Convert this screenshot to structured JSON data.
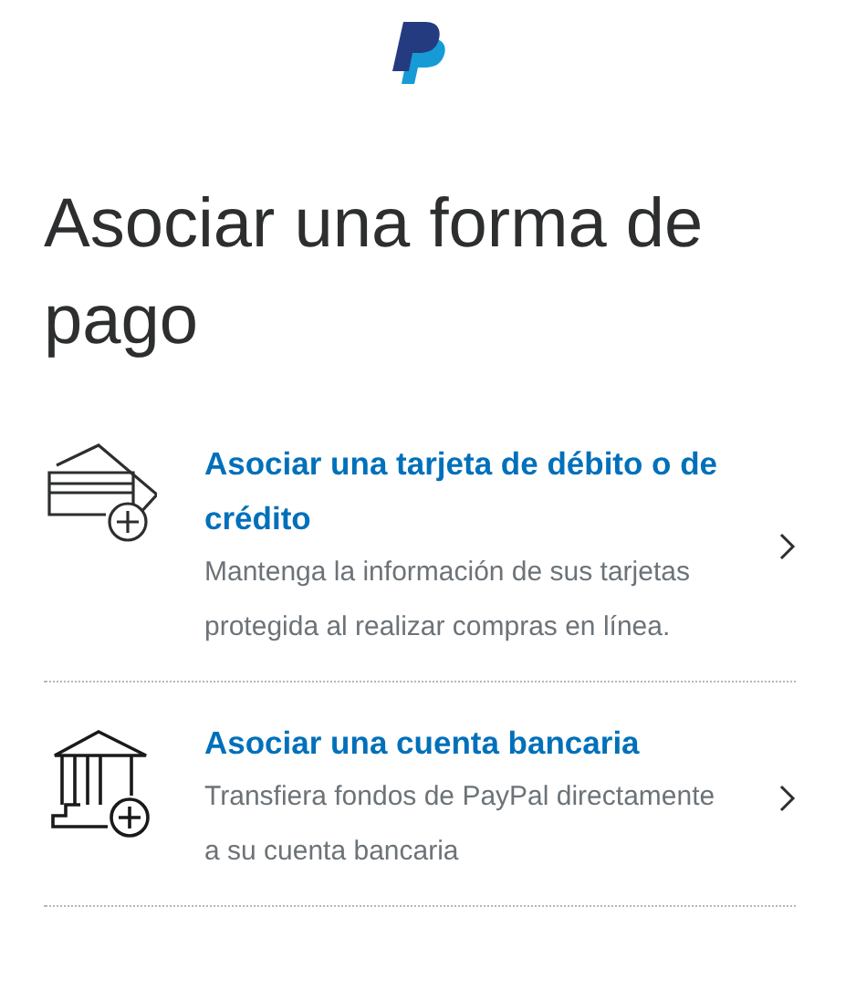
{
  "title": "Asociar una forma de pago",
  "options": [
    {
      "kind": "card",
      "title": "Asociar una tarjeta de débito o de crédito",
      "description": "Mantenga la información de sus tarjetas protegida al realizar compras en línea."
    },
    {
      "kind": "bank",
      "title": "Asociar una cuenta bancaria",
      "description": "Transfiera fondos de PayPal directamente a su cuenta bancaria"
    }
  ]
}
